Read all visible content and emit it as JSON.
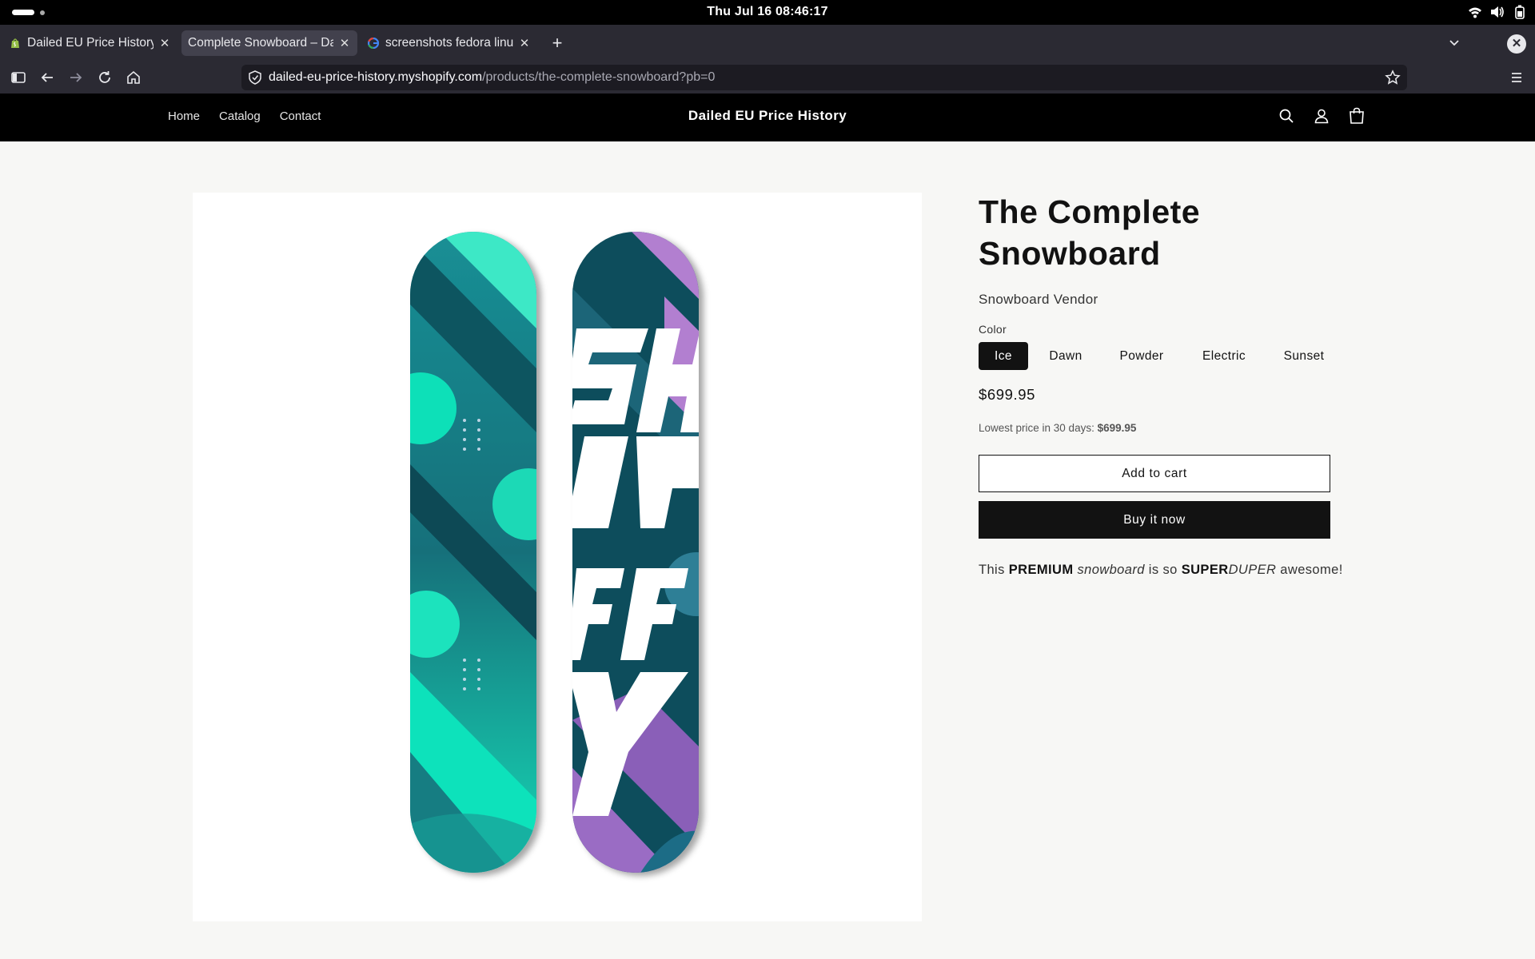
{
  "os": {
    "clock": "Thu Jul 16  08:46:17"
  },
  "browser": {
    "tabs": [
      {
        "title": "Dailed EU Price History",
        "favicon": "shopify-icon",
        "active": false
      },
      {
        "title": "Complete Snowboard – Dai",
        "favicon": "",
        "active": true
      },
      {
        "title": "screenshots fedora linu",
        "favicon": "google-icon",
        "active": false
      }
    ],
    "url": {
      "host": "dailed-eu-price-history.myshopify.com",
      "path": "/products/the-complete-snowboard?pb=0"
    }
  },
  "store": {
    "nav": [
      "Home",
      "Catalog",
      "Contact"
    ],
    "title": "Dailed EU Price History",
    "icons": [
      "search-icon",
      "account-icon",
      "cart-icon"
    ]
  },
  "product": {
    "title": "The Complete Snowboard",
    "vendor": "Snowboard Vendor",
    "color_label": "Color",
    "colors": [
      "Ice",
      "Dawn",
      "Powder",
      "Electric",
      "Sunset"
    ],
    "selected_color": "Ice",
    "price": "$699.95",
    "lowest_label": "Lowest price in 30 days:",
    "lowest_value": "$699.95",
    "add_to_cart": "Add to cart",
    "buy_now": "Buy it now",
    "description": {
      "p1": "This ",
      "b1": "PREMIUM",
      "p2": " ",
      "i1": "snowboard",
      "p3": " is so ",
      "b2": "SUPER",
      "i2": "DUPER",
      "p4": " awesome!"
    },
    "image_lettering": "SHOPIFY",
    "accent_colors": {
      "teal": "#1ad9b6",
      "dark_teal": "#0f5560",
      "purple": "#b27fd0"
    }
  }
}
